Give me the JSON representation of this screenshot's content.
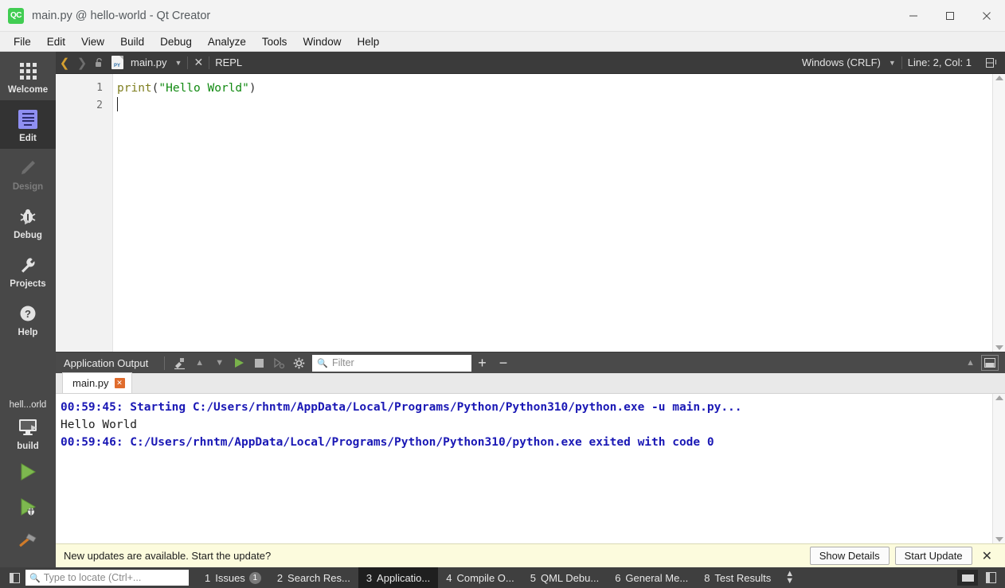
{
  "window": {
    "title": "main.py @ hello-world - Qt Creator",
    "logo_text": "QC",
    "minimize_label": "Minimize",
    "maximize_label": "Maximize",
    "close_label": "Close"
  },
  "menubar": {
    "items": [
      {
        "label": "File"
      },
      {
        "label": "Edit"
      },
      {
        "label": "View"
      },
      {
        "label": "Build"
      },
      {
        "label": "Debug"
      },
      {
        "label": "Analyze"
      },
      {
        "label": "Tools"
      },
      {
        "label": "Window"
      },
      {
        "label": "Help"
      }
    ]
  },
  "modebar": {
    "items": [
      {
        "label": "Welcome",
        "icon": "grid-icon",
        "state": "normal"
      },
      {
        "label": "Edit",
        "icon": "edit-lines-icon",
        "state": "active"
      },
      {
        "label": "Design",
        "icon": "pencil-icon",
        "state": "disabled"
      },
      {
        "label": "Debug",
        "icon": "bug-icon",
        "state": "normal",
        "has_arrow": true
      },
      {
        "label": "Projects",
        "icon": "wrench-icon",
        "state": "normal"
      },
      {
        "label": "Help",
        "icon": "question-circle-icon",
        "state": "normal"
      }
    ],
    "kit": {
      "project_name": "hell...orld",
      "target_label": "build",
      "target_icon": "monitor-icon",
      "run_label": "Run",
      "debug_label": "Start Debugging",
      "build_label": "Build Project"
    }
  },
  "editor_toolbar": {
    "back_label": "Go Back",
    "forward_label": "Go Forward",
    "lock_label": "Make Writable",
    "file_name": "main.py",
    "file_icon_text": "PY",
    "dropdown_label": "Open Documents",
    "close_label": "Close Document",
    "repl_label": "REPL",
    "encoding": "Windows (CRLF)",
    "encoding_caret": "▾",
    "cursor_position": "Line: 2, Col: 1",
    "split_label": "Split"
  },
  "editor": {
    "line_numbers": [
      "1",
      "2"
    ],
    "code_tokens": [
      {
        "text": "print",
        "type": "fn"
      },
      {
        "text": "(",
        "type": "punct"
      },
      {
        "text": "\"Hello World\"",
        "type": "str"
      },
      {
        "text": ")",
        "type": "punct"
      }
    ]
  },
  "output_pane": {
    "title": "Application Output",
    "clear_label": "Clear",
    "prev_label": "Previous Item",
    "next_label": "Next Item",
    "run_label": "Run",
    "stop_label": "Stop",
    "attach_label": "Attach Debugger",
    "settings_label": "Open Settings",
    "filter_placeholder": "Filter",
    "zoom_in_label": "+",
    "zoom_out_label": "−",
    "collapse_label": "Minimize",
    "maximize_label": "Maximize Output Pane",
    "tabs": [
      {
        "label": "main.py",
        "close": "✕",
        "active": true
      }
    ],
    "console_lines": [
      {
        "text": "00:59:45: Starting C:/Users/rhntm/AppData/Local/Programs/Python/Python310/python.exe -u main.py...",
        "type": "sys"
      },
      {
        "text": "Hello World",
        "type": "std"
      },
      {
        "text": "00:59:46: C:/Users/rhntm/AppData/Local/Programs/Python/Python310/python.exe exited with code 0",
        "type": "sys"
      }
    ]
  },
  "notification": {
    "message": "New updates are available. Start the update?",
    "details_button": "Show Details",
    "update_button": "Start Update",
    "close_label": "✕"
  },
  "statusbar": {
    "sidebar_toggle_label": "Toggle Left Sidebar",
    "locate_placeholder": "Type to locate (Ctrl+...",
    "tabs": [
      {
        "num": "1",
        "label": "Issues",
        "badge": "1",
        "active": false
      },
      {
        "num": "2",
        "label": "Search Res...",
        "badge": "",
        "active": false
      },
      {
        "num": "3",
        "label": "Applicatio...",
        "badge": "",
        "active": true
      },
      {
        "num": "4",
        "label": "Compile O...",
        "badge": "",
        "active": false
      },
      {
        "num": "5",
        "label": "QML Debu...",
        "badge": "",
        "active": false
      },
      {
        "num": "6",
        "label": "General Me...",
        "badge": "",
        "active": false
      },
      {
        "num": "8",
        "label": "Test Results",
        "badge": "",
        "active": false
      }
    ],
    "updown_label": "↕",
    "output_toggle_label": "Toggle Output Pane",
    "right_sidebar_toggle_label": "Toggle Right Sidebar"
  },
  "colors": {
    "accent_green": "#41cd52",
    "mode_bar": "#484848",
    "mode_active": "#333333",
    "console_sys": "#1a18b5",
    "notify_bg": "#fcfbdd",
    "status_bar": "#3f3f3f"
  }
}
